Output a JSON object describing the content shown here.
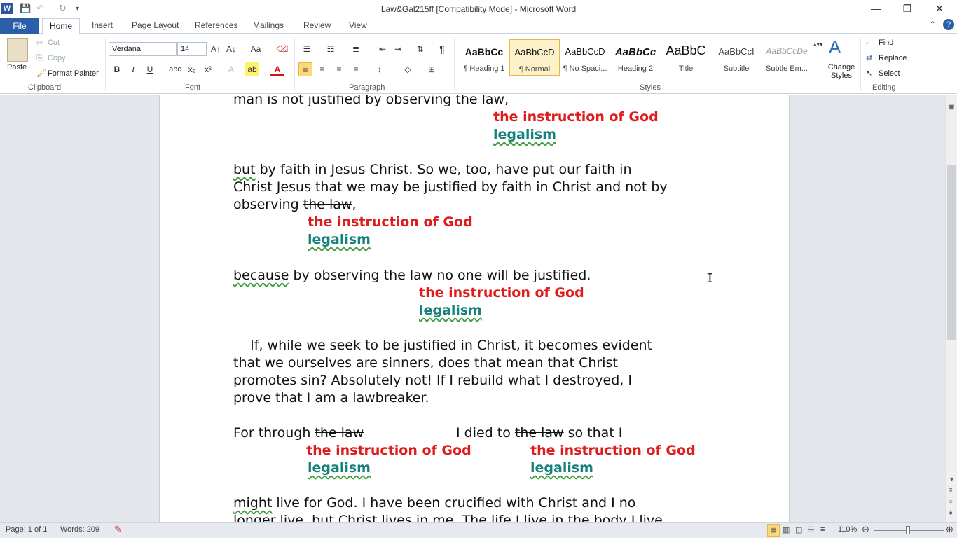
{
  "window": {
    "title": "Law&Gal215ff [Compatibility Mode]  -  Microsoft Word",
    "app_icon_letter": "W",
    "controls": {
      "minimize": "—",
      "restore": "❐",
      "close": "✕"
    }
  },
  "tabs": [
    "File",
    "Home",
    "Insert",
    "Page Layout",
    "References",
    "Mailings",
    "Review",
    "View"
  ],
  "clipboard": {
    "paste": "Paste",
    "cut": "Cut",
    "copy": "Copy",
    "format_painter": "Format Painter",
    "group": "Clipboard"
  },
  "font": {
    "name": "Verdana",
    "size": "14",
    "group": "Font",
    "bold": "B",
    "italic": "I",
    "underline": "U",
    "strike": "abc",
    "sub": "x₂",
    "sup": "x²"
  },
  "paragraph": {
    "group": "Paragraph",
    "pilcrow": "¶"
  },
  "styles": {
    "group": "Styles",
    "items": [
      {
        "sample": "AaBbCc",
        "name": "¶ Heading 1"
      },
      {
        "sample": "AaBbCcD",
        "name": "¶ Normal"
      },
      {
        "sample": "AaBbCcD",
        "name": "¶ No Spaci..."
      },
      {
        "sample": "AaBbCc",
        "name": "Heading 2"
      },
      {
        "sample": "AaBbC",
        "name": "Title"
      },
      {
        "sample": "AaBbCcI",
        "name": "Subtitle"
      },
      {
        "sample": "AaBbCcDe",
        "name": "Subtle Em..."
      }
    ],
    "change_styles": "Change Styles"
  },
  "editing": {
    "group": "Editing",
    "find": "Find",
    "replace": "Replace",
    "select": "Select"
  },
  "document": {
    "line1": {
      "a": "man is not justified by observing ",
      "strike": "the law",
      "b": ","
    },
    "ann1_red": "the instruction of God",
    "ann1_teal": "legalism",
    "p2_l1": {
      "a": "but",
      "b": " by faith in Jesus Christ.  So we, too, have put our faith in"
    },
    "p2_l2": "Christ Jesus that we may be justified by faith in Christ and not by",
    "p2_l3": {
      "a": "observing ",
      "strike": "the law",
      "b": ","
    },
    "ann2_red": "the instruction of God",
    "ann2_teal": "legalism",
    "p3": {
      "a": "because",
      "b": " by observing ",
      "strike": "the law",
      "c": " no one will be justified."
    },
    "ann3_red": "the instruction of God",
    "ann3_teal": "legalism",
    "p4_l1": "    If, while we seek to be justified in Christ, it becomes evident",
    "p4_l2": "that we ourselves are sinners, does that mean that Christ",
    "p4_l3": "promotes sin?  Absolutely not!  If I rebuild what I destroyed, I",
    "p4_l4": "prove that I am a lawbreaker.",
    "p5": {
      "a": "For through ",
      "strike1": "the law",
      "b": "I died to ",
      "strike2": "the law",
      "c": " so that I"
    },
    "ann5a_red": "the instruction of God",
    "ann5a_teal": "legalism",
    "ann5b_red": "the instruction of God",
    "ann5b_teal": "legalism",
    "p6_l1": {
      "a": "might",
      "b": " live for God.  I have been crucified with Christ and I no"
    },
    "p6_l2": "longer live, but Christ lives in me.  The life I live in the body I live"
  },
  "status": {
    "page": "Page: 1 of 1",
    "words": "Words: 209",
    "zoom": "110%"
  }
}
